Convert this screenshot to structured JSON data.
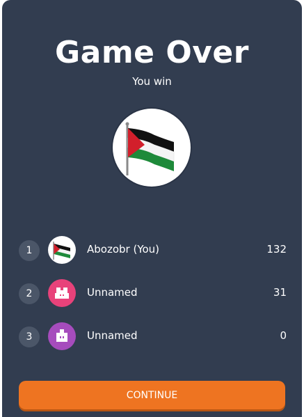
{
  "header": {
    "title": "Game Over",
    "subtitle": "You win"
  },
  "players": [
    {
      "rank": "1",
      "name": "Abozobr (You)",
      "score": "132",
      "avatar": "palestine-flag-icon",
      "color": "#ffffff"
    },
    {
      "rank": "2",
      "name": "Unnamed",
      "score": "31",
      "avatar": "robot-icon",
      "color": "#e8427a"
    },
    {
      "rank": "3",
      "name": "Unnamed",
      "score": "0",
      "avatar": "robot-icon",
      "color": "#a64cbd"
    }
  ],
  "actions": {
    "continue_label": "CONTINUE"
  },
  "colors": {
    "panel": "#323d50",
    "accent": "#ee7421",
    "rank_badge": "#4b5668"
  }
}
